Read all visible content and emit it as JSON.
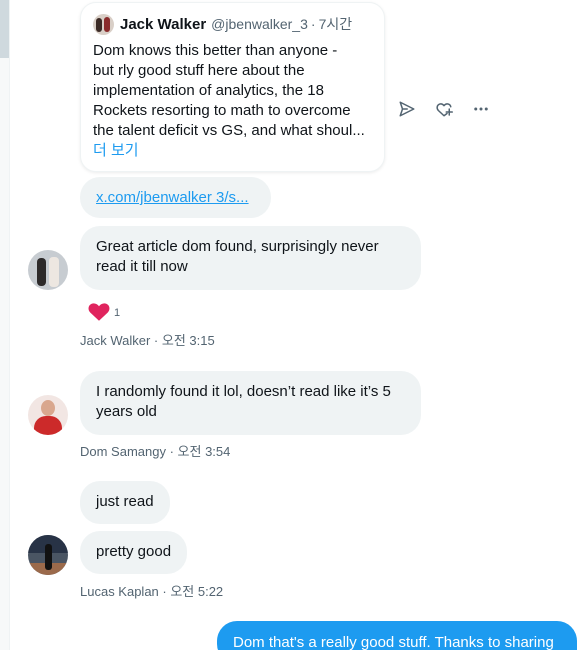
{
  "quoted_tweet": {
    "author_name": "Jack Walker",
    "handle": "@jbenwalker_3",
    "separator": "·",
    "time": "7시간",
    "lines": [
      "Dom knows this better than anyone -",
      "but rly good stuff here about the",
      "implementation of analytics, the 18",
      "Rockets resorting to math to overcome",
      "the talent deficit vs GS, and what shoul..."
    ],
    "more_label": "더 보기"
  },
  "actions": {
    "icons": [
      "send-icon",
      "heart-plus-icon",
      "more-icon"
    ]
  },
  "link": {
    "text": "x.com/jbenwalker 3/s..."
  },
  "messages": [
    {
      "sender": "Jack Walker",
      "lines": [
        "Great article dom found, surprisingly never",
        "read it till now"
      ],
      "reaction": {
        "icon": "heart-icon",
        "count": "1",
        "color": "#f91880"
      },
      "meta": "Jack Walker · 오전 3:15"
    },
    {
      "sender": "Dom Samangy",
      "lines": [
        "I randomly found it lol, doesn’t read like it’s 5",
        "years old"
      ],
      "meta": "Dom Samangy · 오전 3:54"
    },
    {
      "sender": "Lucas Kaplan",
      "texts": [
        "just read",
        "pretty good"
      ],
      "meta": "Lucas Kaplan · 오전 5:22"
    }
  ],
  "my_message": {
    "text": "Dom that's a really good stuff. Thanks to sharing"
  },
  "colors": {
    "accent": "#1d9bf0",
    "bubble": "#eff3f4",
    "muted": "#536471",
    "heart": "#f91880"
  }
}
